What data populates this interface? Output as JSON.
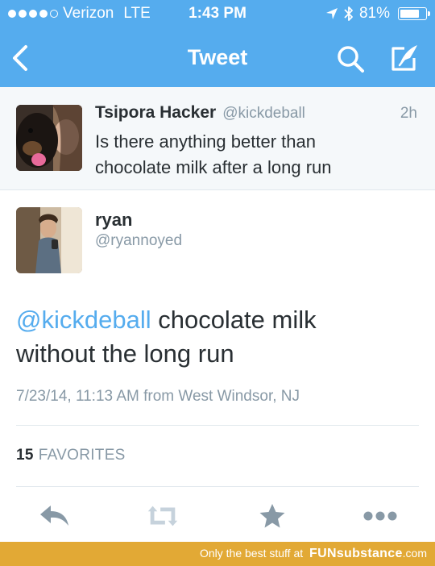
{
  "status_bar": {
    "carrier": "Verizon",
    "network": "LTE",
    "time": "1:43 PM",
    "battery_percent": "81%",
    "battery_level": 0.81,
    "signal_bars": 4,
    "icons": [
      "signal-dots-icon",
      "location-arrow-icon",
      "bluetooth-icon",
      "battery-icon"
    ]
  },
  "nav": {
    "title": "Tweet",
    "icons": [
      "back-chevron-icon",
      "search-icon",
      "compose-icon"
    ]
  },
  "reply_to": {
    "name": "Tsipora Hacker",
    "handle": "@kickdeball",
    "time": "2h",
    "text_lines": [
      "Is there anything better than",
      "chocolate milk after a long run"
    ]
  },
  "tweet": {
    "name": "ryan",
    "handle": "@ryannoyed",
    "mention": "@kickdeball",
    "text_line1_rest": " chocolate milk",
    "text_line2": "without the long run",
    "meta": "7/23/14, 11:13 AM from West Windsor, NJ",
    "favorites_count": "15",
    "favorites_label": "FAVORITES"
  },
  "actions": {
    "icons": [
      "reply-icon",
      "retweet-icon",
      "favorite-star-icon",
      "more-dots-icon"
    ]
  },
  "watermark": {
    "prefix": "Only the best stuff at",
    "brand": "FUNsubstance",
    "suffix": ".com"
  },
  "colors": {
    "twitter_blue": "#55acee",
    "text_dark": "#292f33",
    "text_gray": "#8899a6",
    "action_gray": "#8899a6",
    "watermark_gold": "#e2a935"
  }
}
